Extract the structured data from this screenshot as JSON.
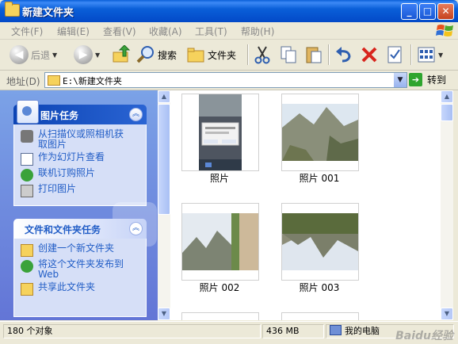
{
  "window": {
    "title": "新建文件夹",
    "minimize": "_",
    "maximize": "□",
    "close": "✕"
  },
  "menu": [
    "文件(F)",
    "编辑(E)",
    "查看(V)",
    "收藏(A)",
    "工具(T)",
    "帮助(H)"
  ],
  "toolbar": {
    "back_label": "后退",
    "search_label": "搜索",
    "folders_label": "文件夹"
  },
  "address": {
    "label": "地址(D)",
    "value": "E:\\新建文件夹",
    "go_label": "转到"
  },
  "left_pane": {
    "picture_tasks": {
      "title": "图片任务",
      "items": [
        "从扫描仪或照相机获取图片",
        "作为幻灯片查看",
        "联机订购照片",
        "打印图片"
      ]
    },
    "file_tasks": {
      "title": "文件和文件夹任务",
      "items": [
        "创建一个新文件夹",
        "将这个文件夹发布到 Web",
        "共享此文件夹"
      ]
    }
  },
  "files": [
    {
      "name": "照片"
    },
    {
      "name": "照片 001"
    },
    {
      "name": "照片 002"
    },
    {
      "name": "照片 003"
    }
  ],
  "status": {
    "count": "180 个对象",
    "size": "436 MB",
    "location": "我的电脑"
  },
  "watermark": "Baidu经验",
  "colors": {
    "titlebar": "#0a5fd8",
    "task_pane": "#7ba2e7",
    "task_link": "#215dc6"
  }
}
